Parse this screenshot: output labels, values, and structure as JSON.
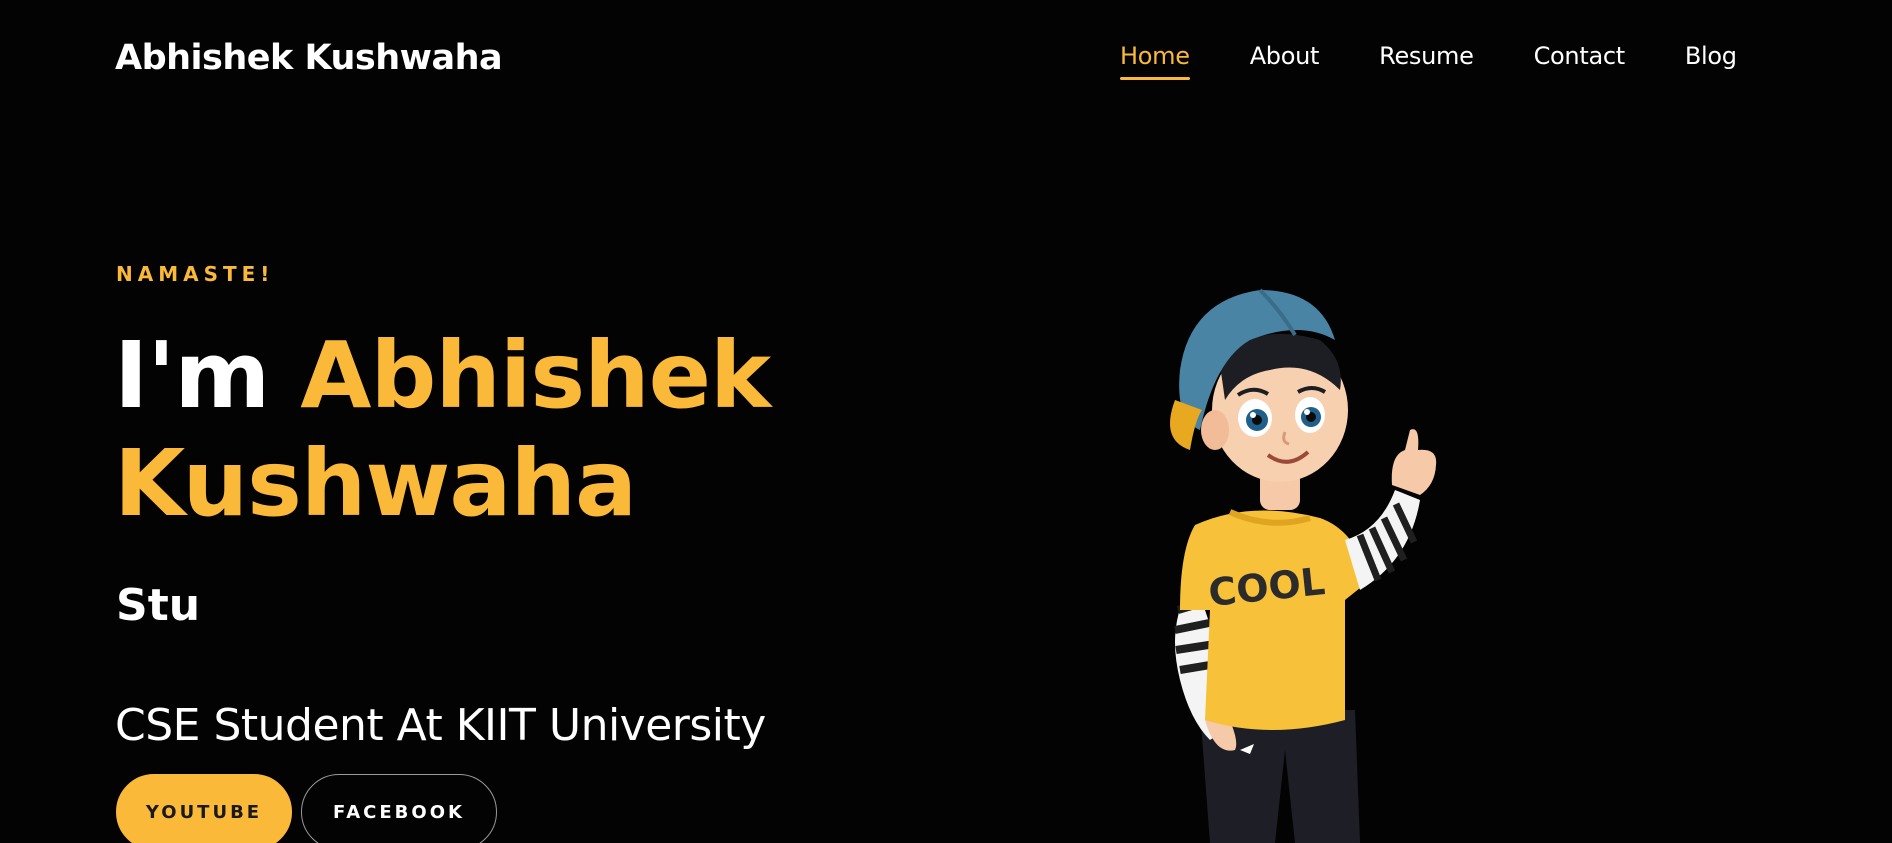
{
  "header": {
    "brand": "Abhishek Kushwaha",
    "nav": [
      {
        "label": "Home",
        "active": true
      },
      {
        "label": "About",
        "active": false
      },
      {
        "label": "Resume",
        "active": false
      },
      {
        "label": "Contact",
        "active": false
      },
      {
        "label": "Blog",
        "active": false
      }
    ]
  },
  "hero": {
    "greeting": "NAMASTE!",
    "title_prefix": "I'm ",
    "title_name": "Abhishek Kushwaha",
    "typed_text": "Stu",
    "subtitle": "CSE Student At KIIT University",
    "buttons": {
      "youtube": "YOUTUBE",
      "facebook": "FACEBOOK"
    },
    "illustration": {
      "tshirt_text": "COOL"
    }
  },
  "colors": {
    "background": "#030303",
    "accent": "#fbb93a",
    "text": "#ffffff"
  },
  "icons": [
    "cartoon-boy-illustration"
  ]
}
